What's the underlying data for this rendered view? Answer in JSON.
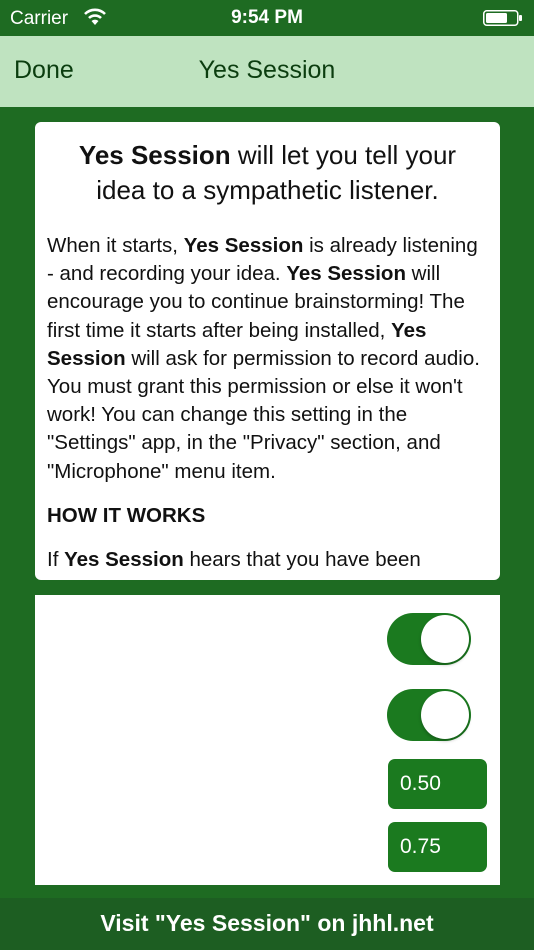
{
  "status_bar": {
    "carrier": "Carrier",
    "time": "9:54 PM",
    "wifi_icon": "wifi-icon",
    "battery_icon": "battery-icon"
  },
  "nav": {
    "done_label": "Done",
    "title": "Yes Session"
  },
  "info": {
    "headline_bold": "Yes Session",
    "headline_rest": " will let you tell your idea to a sympathetic listener.",
    "p1_a": "When it starts, ",
    "p1_b": "Yes Session",
    "p1_c": " is already listening - and recording your idea. ",
    "p1_d": "Yes Session",
    "p1_e": " will encourage you to continue brainstorming! The first time it starts after being installed, ",
    "p1_f": "Yes Session",
    "p1_g": " will ask for permission to record audio. You must grant this permission or else it won't work! You can change this setting in the \"Settings\" app, in the \"Privacy\" section, and \"Microphone\" menu item.",
    "how_heading": "HOW IT WORKS",
    "p2_a": "If ",
    "p2_b": "Yes Session",
    "p2_c": " hears that you have been"
  },
  "controls": {
    "toggle1_on": true,
    "toggle2_on": true,
    "value1": "0.50",
    "value2": "0.75"
  },
  "footer": {
    "link_label": "Visit \"Yes Session\" on jhhl.net"
  },
  "colors": {
    "background": "#1e6b22",
    "nav_bar": "#bfe3c0",
    "control_green": "#1b7a1f",
    "footer": "#1d5e22"
  }
}
